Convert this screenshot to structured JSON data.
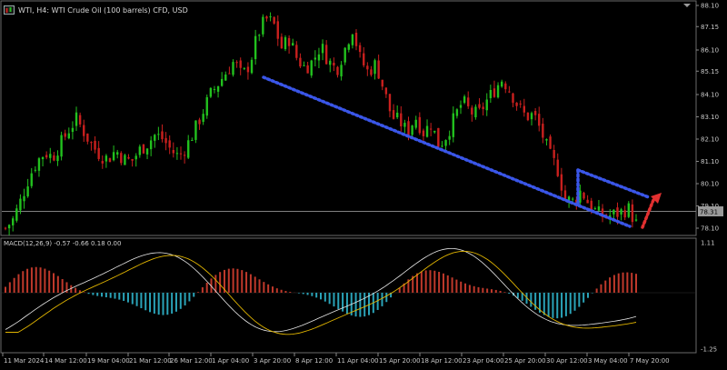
{
  "chart_title": "WTI, H4:  WTI Crude Oil (100 barrels) CFD, USD",
  "current_price": "78.31",
  "macd_label": "MACD(12,26,9) -0.57 -0.66 0.18 0.00",
  "price_axis_labels": [
    "88.10",
    "87.15",
    "86.10",
    "85.15",
    "84.10",
    "83.10",
    "82.10",
    "81.10",
    "80.10",
    "79.10",
    "78.10"
  ],
  "macd_axis_labels": [
    "1.11",
    "-1.25"
  ],
  "time_axis_labels": [
    "11 Mar 2024",
    "14 Mar 12:00",
    "19 Mar 04:00",
    "21 Mar 12:00",
    "26 Mar 12:00",
    "1 Apr 04:00",
    "3 Apr 20:00",
    "8 Apr 12:00",
    "11 Apr 04:00",
    "15 Apr 20:00",
    "18 Apr 12:00",
    "23 Apr 04:00",
    "25 Apr 20:00",
    "30 Apr 12:00",
    "3 May 04:00",
    "7 May 20:00"
  ],
  "colors": {
    "background": "#000000",
    "bull_candle": "#22c11e",
    "bear_candle": "#c9201e",
    "channel_line": "#3a56e8",
    "arrow": "#e23030",
    "macd_positive": "#c0392b",
    "macd_negative": "#2aa3b8",
    "macd_line": "#e6e6e6",
    "signal_line": "#e0b400",
    "axis_text": "#c8c8c8",
    "grid_line": "#555555"
  },
  "icons": {
    "chart_icon": "chart-window-icon",
    "menu_arrow": "dropdown-arrow-icon"
  },
  "chart_data": {
    "type": "candlestick",
    "title": "WTI, H4:  WTI Crude Oil (100 barrels) CFD, USD",
    "close_path": [
      78.1,
      78.5,
      79.4,
      80.4,
      81.1,
      81.5,
      81.3,
      81.9,
      82.5,
      83.0,
      82.4,
      81.8,
      81.4,
      81.2,
      81.6,
      81.2,
      81.1,
      81.6,
      81.9,
      82.3,
      82.1,
      81.6,
      81.3,
      81.8,
      82.5,
      83.3,
      84.1,
      84.6,
      85.1,
      85.6,
      84.9,
      85.5,
      86.8,
      87.5,
      87.3,
      86.2,
      86.6,
      85.7,
      85.3,
      85.6,
      86.3,
      85.6,
      85.2,
      86.1,
      87.1,
      85.7,
      85.1,
      85.5,
      84.3,
      83.1,
      82.9,
      82.4,
      83.1,
      82.4,
      82.8,
      81.8,
      82.3,
      83.1,
      83.8,
      83.3,
      83.2,
      83.8,
      84.3,
      84.8,
      84.3,
      83.6,
      83.1,
      83.2,
      82.4,
      81.4,
      80.8,
      79.4,
      79.3,
      79.8,
      79.2,
      78.8,
      78.6,
      78.7,
      78.8,
      79.0,
      78.3
    ],
    "price_axis": [
      "88.10",
      "87.15",
      "86.10",
      "85.15",
      "84.10",
      "83.10",
      "82.10",
      "81.10",
      "80.10",
      "79.10",
      "78.10"
    ],
    "current_price": 78.31,
    "macd": {
      "label": "MACD(12,26,9) -0.57 -0.66 0.18 0.00",
      "range": [
        -1.25,
        1.11
      ]
    }
  }
}
